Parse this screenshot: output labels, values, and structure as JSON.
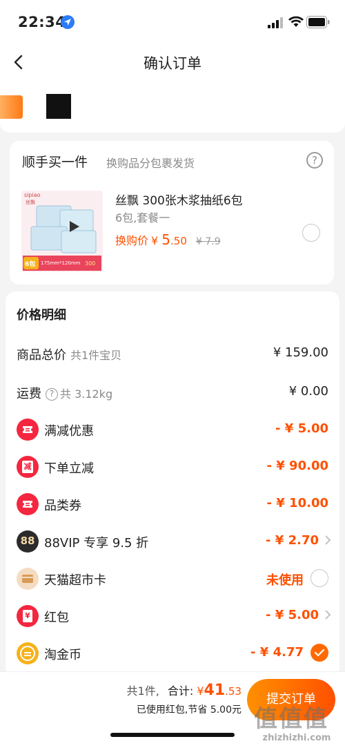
{
  "status_bar": {
    "time": "22:34"
  },
  "nav": {
    "title": "确认订单"
  },
  "addon": {
    "title": "顺手买一件",
    "subtitle": "换购品分包裹发货",
    "help": "?",
    "product": {
      "brand": "sipiao",
      "brand_cn": "丝飘",
      "name": "丝飘 300张木浆抽纸6包",
      "spec": "6包,套餐一",
      "price_label": "换购价",
      "price_currency": "¥",
      "price_int": "5",
      "price_dec": ".50",
      "original_price": "¥ 7.9",
      "thumb_badge": "6包",
      "thumb_size": "175mm*120mm",
      "thumb_count": "300"
    }
  },
  "price_details": {
    "heading": "价格明细",
    "rows": {
      "goods_total": {
        "label": "商品总价",
        "sub": "共1件宝贝",
        "value": "¥ 159.00"
      },
      "shipping": {
        "label": "运费",
        "help": "?",
        "sub": "共 3.12kg",
        "value": "¥ 0.00"
      },
      "full_reduction": {
        "label": "满减优惠",
        "value": "- ¥ 5.00",
        "icon": "ticket-icon"
      },
      "order_reduction": {
        "label": "下单立减",
        "value": "- ¥ 90.00",
        "icon": "reduce-icon",
        "icon_text": "减"
      },
      "category_coupon": {
        "label": "品类券",
        "value": "- ¥ 10.00",
        "icon": "ticket-icon"
      },
      "vip": {
        "label": "88VIP 专享 9.5 折",
        "value": "- ¥ 2.70",
        "icon": "vip88-icon",
        "icon_text": "88"
      },
      "tmall_card": {
        "label": "天猫超市卡",
        "value": "未使用",
        "icon": "card-icon"
      },
      "red_packet": {
        "label": "红包",
        "value": "- ¥ 5.00",
        "icon": "red-packet-icon",
        "icon_text": "¥"
      },
      "gold_coin": {
        "label": "淘金币",
        "value": "- ¥ 4.77",
        "icon": "coin-icon"
      }
    }
  },
  "bottom": {
    "count": "共1件,",
    "total_label": "合计:",
    "total_currency": "¥",
    "total_int": "41",
    "total_dec": ".53",
    "saving": "已使用红包,节省 5.00元",
    "submit": "提交订单"
  },
  "watermark": {
    "text": "zhizhizhi.com",
    "glyphs": "值值值"
  },
  "colors": {
    "accent": "#ff5000",
    "red_icon": "#f5263f",
    "background": "#f4f4f4"
  }
}
